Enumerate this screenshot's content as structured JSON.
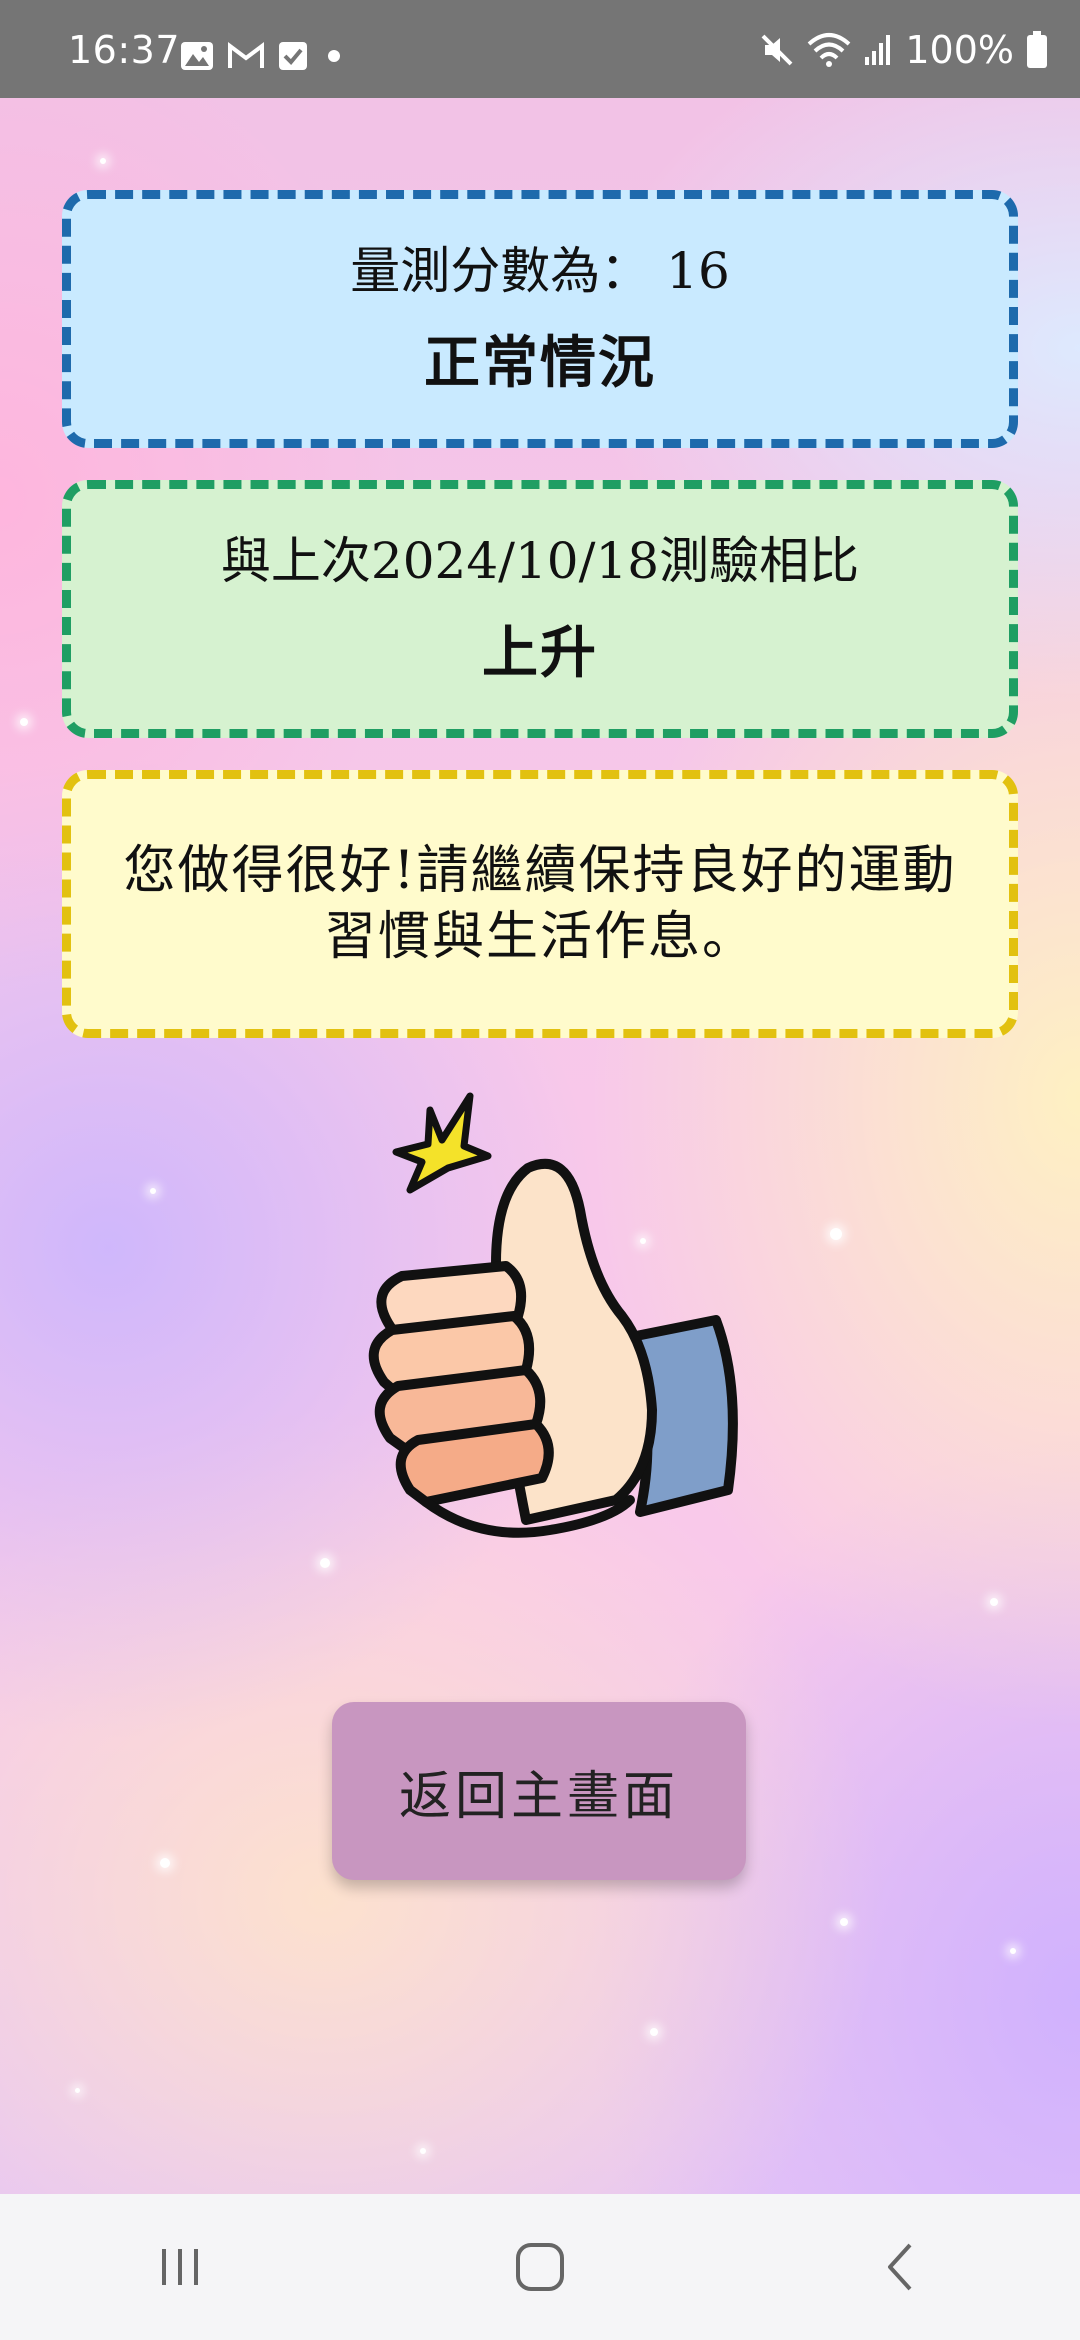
{
  "status_bar": {
    "time": "16:37",
    "left_icons": [
      "image-icon",
      "gmail-icon",
      "checkbox-icon",
      "dot-icon"
    ],
    "right_icons": [
      "mute-icon",
      "wifi-icon",
      "signal-icon",
      "battery-icon"
    ],
    "battery": "100%"
  },
  "score_card": {
    "line": "量測分數為： 16",
    "status": "正常情況",
    "border_color": "#1e6aac",
    "background": "#c9eaff"
  },
  "compare_card": {
    "line": "與上次2024/10/18測驗相比",
    "result": "上升",
    "border_color": "#1f9e63",
    "background": "#d6f2d0"
  },
  "message_card": {
    "text": "您做得很好!請繼續保持良好的運動習慣與生活作息。",
    "border_color": "#e2c110",
    "background": "#fffbcc"
  },
  "illustration": {
    "icon": "thumbs-up-icon"
  },
  "return_button": {
    "label": "返回主畫面",
    "color": "#c896c0"
  },
  "nav_bar": {
    "items": [
      "recent-apps-icon",
      "home-icon",
      "back-icon"
    ]
  }
}
